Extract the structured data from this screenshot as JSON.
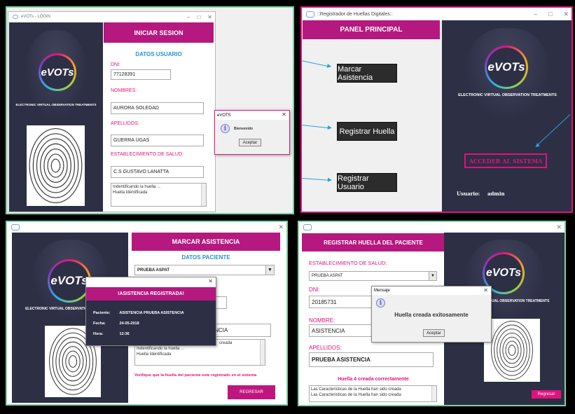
{
  "brand": {
    "logo_text": "eVOTs",
    "tagline": "ELECTRONIC VIRTUAL OBSERVATION TREATMENTS"
  },
  "login": {
    "window_title": "eVOTs - LOGIN",
    "header": "INICIAR SESION",
    "section": "DATOS USUARIO",
    "dni_label": "DNI:",
    "dni_value": "77128391",
    "nombres_label": "NOMBRES:",
    "nombres_value": "AURORA SOLEDAD",
    "apellidos_label": "APELLIDOS:",
    "apellidos_value": "GUERRA UGAS",
    "estab_label": "ESTABLECIMIENTO DE SALUD:",
    "estab_value": "C.S GUSTAVO LANATTA",
    "log_lines": [
      "Indentificando la huella ...",
      "Huella Identificada"
    ],
    "dialog": {
      "title": "eVOTS",
      "message": "Bienvenido",
      "ok": "Aceptar"
    }
  },
  "panel": {
    "window_title": "::Registrador de Huellas Digitales::",
    "header": "PANEL PRINCIPAL",
    "buttons": [
      "Marcar Asistencia",
      "Registrar Huella",
      "Registrar Usuario"
    ],
    "access_button": "ACCEDER AL SISTEMA",
    "user_label": "Usuario:",
    "user_value": "admin"
  },
  "asistencia": {
    "header": "MARCAR ASISTENCIA",
    "section": "DATOS PACIENTE",
    "select_value": "PRUEBA ASPAT",
    "partial_value": "TENCIA",
    "log_lines": [
      "Indentificando la huella ...",
      "Huella Identificada"
    ],
    "partial_log": "creada",
    "warning": "Verifique que la huella del paciente este registrado en el sistema",
    "back_button": "REGRESAR",
    "dialog": {
      "header": "!ASISTENCIA REGISTRADA!",
      "rows": [
        {
          "label": "Paciente:",
          "value": "ASISTENCIA PRUEBA ASISTENCIA"
        },
        {
          "label": "Fecha:",
          "value": "24-05-2018"
        },
        {
          "label": "Hora:",
          "value": "12:36"
        }
      ]
    }
  },
  "huella": {
    "header": "REGISTRAR HUELLA DEL PACIENTE",
    "estab_label": "ESTABLECIMIENTO DE SALUD:",
    "estab_value": "PRUEBA ASPAT",
    "dni_label": "DNI:",
    "dni_value": "20185731",
    "nombre_label": "NOMBRE:",
    "nombre_value": "ASISTENCIA",
    "apellidos_label": "APELLIDOS:",
    "apellidos_value": "PRUEBA ASISTENCIA",
    "status": "Huella 4 creada correctamente",
    "log_lines": [
      "Las Caracteristicas de la Huella han sido creada",
      "Las Caracteristicas de la Huella han sido creada"
    ],
    "back_button": "Regresar",
    "dialog": {
      "title": "Mensaje",
      "message": "Huella creada exitosamente",
      "ok": "Aceptar"
    }
  }
}
